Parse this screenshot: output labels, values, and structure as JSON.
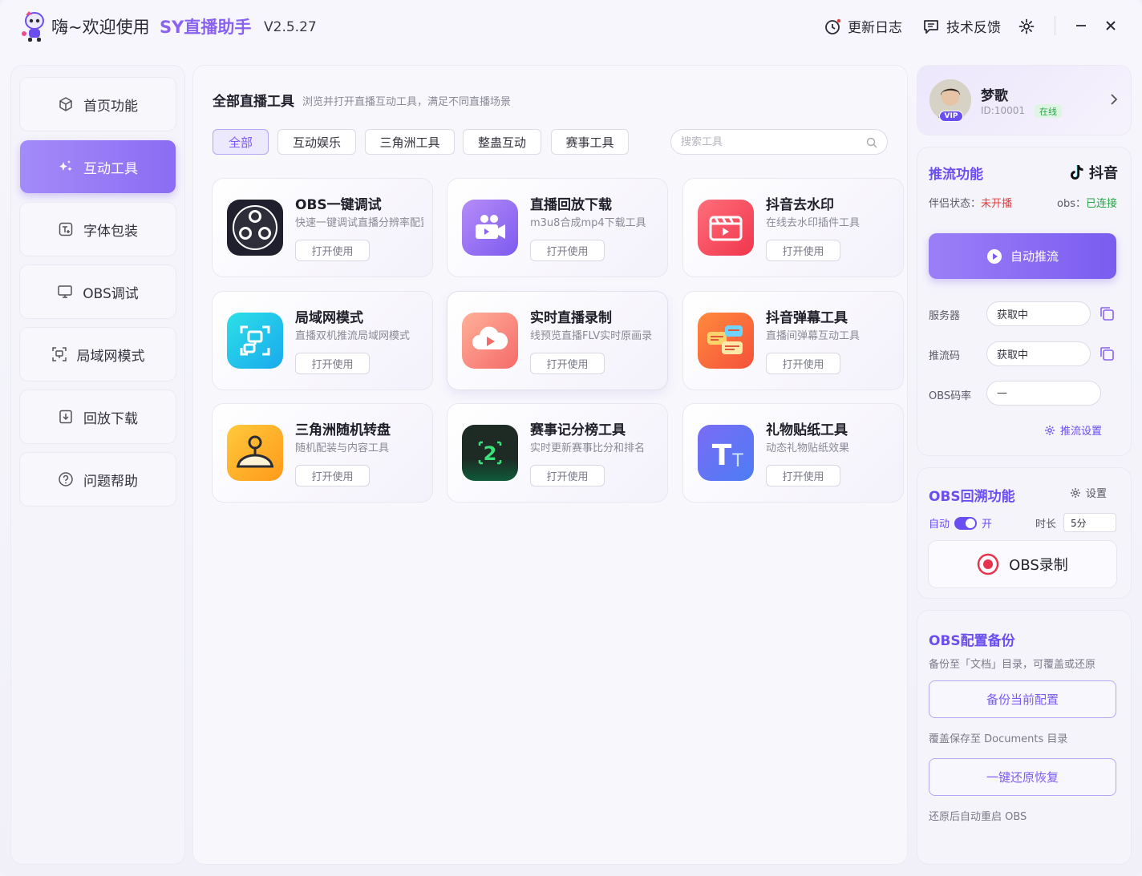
{
  "titlebar": {
    "greeting": "嗨~欢迎使用",
    "app_name": "SY直播助手",
    "version": "V2.5.27",
    "changelog_label": "更新日志",
    "feedback_label": "技术反馈"
  },
  "sidebar": {
    "items": [
      {
        "label": "首页功能",
        "icon": "cube-icon"
      },
      {
        "label": "互动工具",
        "icon": "sparkle-icon",
        "active": true
      },
      {
        "label": "字体包装",
        "icon": "font-icon"
      },
      {
        "label": "OBS调试",
        "icon": "monitor-icon"
      },
      {
        "label": "局域网模式",
        "icon": "lan-icon"
      },
      {
        "label": "回放下载",
        "icon": "download-icon"
      },
      {
        "label": "问题帮助",
        "icon": "help-icon"
      }
    ]
  },
  "main": {
    "title": "全部直播工具",
    "subtitle": "浏览并打开直播互动工具，满足不同直播场景",
    "filters": [
      "全部",
      "互动娱乐",
      "三角洲工具",
      "整蛊互动",
      "赛事工具"
    ],
    "search_placeholder": "搜索工具",
    "open_label": "打开使用",
    "tools": [
      {
        "title": "OBS一键调试",
        "desc": "快速一键调试直播分辨率配置"
      },
      {
        "title": "直播回放下载",
        "desc": "m3u8合成mp4下载工具"
      },
      {
        "title": "抖音去水印",
        "desc": "在线去水印插件工具"
      },
      {
        "title": "局域网模式",
        "desc": "直播双机推流局域网模式"
      },
      {
        "title": "实时直播录制",
        "desc": "线预览直播FLV实时原画录"
      },
      {
        "title": "抖音弹幕工具",
        "desc": "直播间弹幕互动工具"
      },
      {
        "title": "三角洲随机转盘",
        "desc": "随机配装与内容工具"
      },
      {
        "title": "赛事记分榜工具",
        "desc": "实时更新赛事比分和排名"
      },
      {
        "title": "礼物贴纸工具",
        "desc": "动态礼物贴纸效果"
      }
    ]
  },
  "user": {
    "name": "梦歌",
    "id": "ID:10001",
    "status": "在线",
    "vip": "VIP"
  },
  "push": {
    "title": "推流功能",
    "platform": "抖音",
    "partner_label": "伴侣状态：",
    "partner_value": "未开播",
    "obs_label": "obs：",
    "obs_value": "已连接",
    "button": "自动推流",
    "server_label": "服务器",
    "server_value": "获取中",
    "key_label": "推流码",
    "key_value": "获取中",
    "bitrate_label": "OBS码率",
    "bitrate_value": "—",
    "settings_label": "推流设置"
  },
  "obs_replay": {
    "title": "OBS回溯功能",
    "settings_label": "设置",
    "auto_label": "自动",
    "toggle_state": "开",
    "duration_label": "时长",
    "duration_value": "5分",
    "record_label": "OBS录制"
  },
  "backup": {
    "title": "OBS配置备份",
    "desc": "备份至「文档」目录，可覆盖或还原",
    "backup_button": "备份当前配置",
    "backup_note": "覆盖保存至 Documents 目录",
    "restore_button": "一键还原恢复",
    "restore_note": "还原后自动重启 OBS"
  },
  "colors": {
    "accent": "#7a5cf0",
    "online": "#22a544",
    "offline": "#e63b3b"
  }
}
